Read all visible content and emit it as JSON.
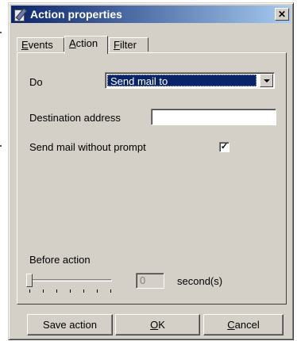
{
  "window": {
    "title": "Action properties",
    "close_symbol": "✕"
  },
  "tabs": [
    {
      "label": "Events",
      "accel": "E",
      "rest": "vents"
    },
    {
      "label": "Action",
      "accel": "A",
      "rest": "ction",
      "active": true
    },
    {
      "label": "Filter",
      "accel": "F",
      "rest": "ilter"
    }
  ],
  "form": {
    "do_label": "Do",
    "do_value": "Send mail to",
    "destination_label": "Destination address",
    "destination_value": "",
    "prompt_label": "Send mail without prompt",
    "prompt_checked": true,
    "before_action_label": "Before action",
    "before_action_value": "0",
    "seconds_label": "second(s)",
    "slider_fraction": 0
  },
  "buttons": {
    "save": "Save action",
    "ok_accel": "O",
    "ok_rest": "K",
    "cancel_accel": "C",
    "cancel_rest": "ancel"
  },
  "colors": {
    "dialog_face": "#d4d0c8",
    "title_start": "#0a246a",
    "title_end": "#a6caf0",
    "selection": "#0a246a"
  },
  "icons": {
    "app": "properties-icon",
    "close": "close-icon",
    "dropdown": "chevron-down-icon",
    "check": "checkmark-icon"
  }
}
